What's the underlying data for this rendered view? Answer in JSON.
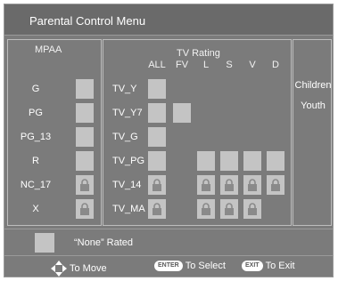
{
  "title": "Parental Control Menu",
  "mpaa": {
    "header": "MPAA",
    "ratings": [
      {
        "label": "G",
        "state": "unlocked"
      },
      {
        "label": "PG",
        "state": "unlocked"
      },
      {
        "label": "PG_13",
        "state": "unlocked"
      },
      {
        "label": "R",
        "state": "unlocked"
      },
      {
        "label": "NC_17",
        "state": "locked"
      },
      {
        "label": "X",
        "state": "locked"
      }
    ]
  },
  "tv": {
    "header": "TV Rating",
    "columns": [
      "ALL",
      "FV",
      "L",
      "S",
      "V",
      "D"
    ],
    "rows": [
      {
        "label": "TV_Y",
        "cells": [
          "unlocked",
          "none",
          "none",
          "none",
          "none",
          "none"
        ]
      },
      {
        "label": "TV_Y7",
        "cells": [
          "unlocked",
          "unlocked",
          "none",
          "none",
          "none",
          "none"
        ]
      },
      {
        "label": "TV_G",
        "cells": [
          "unlocked",
          "none",
          "none",
          "none",
          "none",
          "none"
        ]
      },
      {
        "label": "TV_PG",
        "cells": [
          "unlocked",
          "none",
          "unlocked",
          "unlocked",
          "unlocked",
          "unlocked"
        ]
      },
      {
        "label": "TV_14",
        "cells": [
          "locked",
          "none",
          "locked",
          "locked",
          "locked",
          "locked"
        ]
      },
      {
        "label": "TV_MA",
        "cells": [
          "locked",
          "none",
          "locked",
          "locked",
          "locked",
          "none"
        ]
      }
    ]
  },
  "subgroups": {
    "children": "Children",
    "youth": "Youth"
  },
  "legend": {
    "none_rated": "“None” Rated"
  },
  "help": {
    "move": "To Move",
    "enter_key": "ENTER",
    "select": "To Select",
    "exit_key": "EXIT",
    "exit": "To Exit"
  },
  "colors": {
    "background": "#7b7b7b",
    "box": "#c4c4c4",
    "lock": "#8a8a8a",
    "text": "#ffffff"
  },
  "icons": {
    "lock": "padlock-icon",
    "move": "four-way-arrow-icon"
  }
}
